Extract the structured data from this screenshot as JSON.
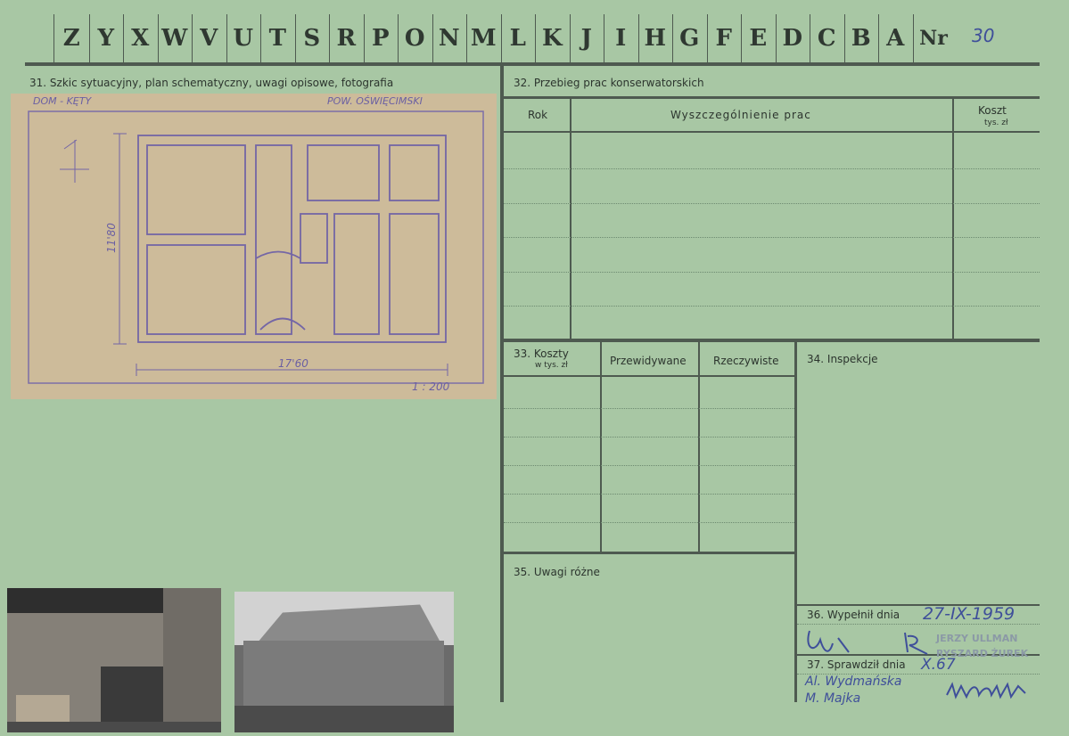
{
  "header": {
    "letters": [
      "Z",
      "Y",
      "X",
      "W",
      "V",
      "U",
      "T",
      "S",
      "R",
      "P",
      "O",
      "N",
      "M",
      "L",
      "K",
      "J",
      "I",
      "H",
      "G",
      "F",
      "E",
      "D",
      "C",
      "B",
      "A"
    ],
    "nr_label": "Nr",
    "nr_value": "30"
  },
  "sections": {
    "s31": "31. Szkic sytuacyjny, plan schematyczny, uwagi opisowe, fotografia",
    "s32": "32. Przebieg prac konserwatorskich",
    "s33": "33. Koszty",
    "s33_sub": "w tys. zł",
    "s33_col2": "Przewidywane",
    "s33_col3": "Rzeczywiste",
    "s34": "34. Inspekcje",
    "s35": "35. Uwagi różne",
    "s36": "36. Wypełnił dnia",
    "s37": "37. Sprawdził dnia"
  },
  "works_table": {
    "col_rok": "Rok",
    "col_desc": "Wyszczególnienie prac",
    "col_cost": "Koszt",
    "col_cost_sub": "tys. zł"
  },
  "sketch": {
    "top_left": "DOM - KĘTY",
    "top_right": "POW. OŚWIĘCIMSKI",
    "number": "1",
    "dim_v": "11'80",
    "dim_h": "17'60",
    "scale": "1 : 200"
  },
  "handwriting": {
    "filled_date": "27-IX-1959",
    "checked_date": "X.67",
    "checked_names": "Al. Wydmańska\nM. Majka"
  },
  "stamps": {
    "line1": "JERZY ULLMAN",
    "line2": "RYSZARD ŻUREK"
  }
}
